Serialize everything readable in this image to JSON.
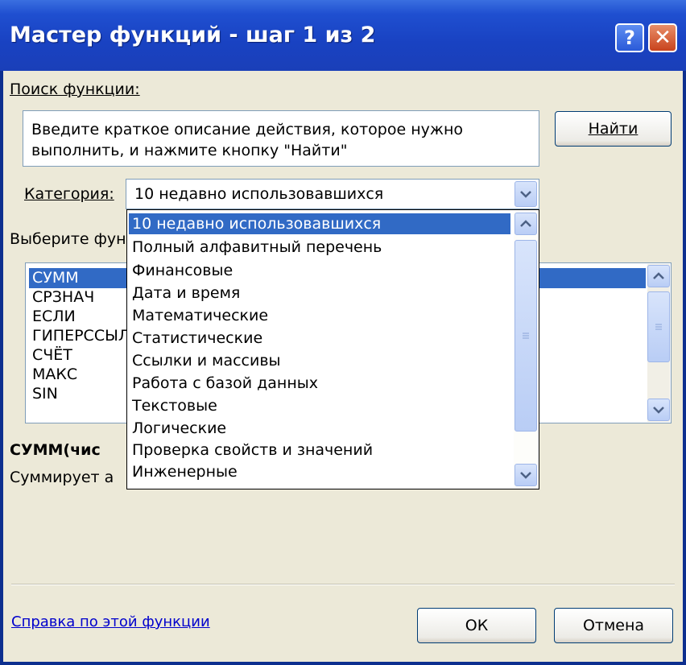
{
  "window": {
    "title": "Мастер функций - шаг 1 из 2",
    "help_glyph": "?",
    "close_glyph": "✕"
  },
  "search": {
    "label": "Поиск функции:",
    "description": "Введите краткое описание действия, которое нужно выполнить, и нажмите кнопку \"Найти\"",
    "find_button": "Найти"
  },
  "category": {
    "label": "Категория:",
    "selected": "10 недавно использовавшихся",
    "options": [
      "10 недавно использовавшихся",
      "Полный алфавитный перечень",
      "Финансовые",
      "Дата и время",
      "Математические",
      "Статистические",
      "Ссылки и массивы",
      "Работа с базой данных",
      "Текстовые",
      "Логические",
      "Проверка свойств и значений",
      "Инженерные"
    ]
  },
  "functions": {
    "label_visible": "Выберите фун",
    "items_visible": [
      "СУММ",
      "СРЗНАЧ",
      "ЕСЛИ",
      "ГИПЕРССЫЛ",
      "СЧЁТ",
      "МАКС",
      "SIN"
    ],
    "selected": "СУММ",
    "signature_visible": "СУММ(чис",
    "description_visible": "Суммирует а"
  },
  "footer": {
    "help_link": "Справка по этой функции",
    "ok_button": "ОК",
    "cancel_button": "Отмена"
  },
  "colors": {
    "titlebar": "#1f4fd0",
    "dialog_bg": "#ece9d8",
    "selection": "#316ac5",
    "link": "#0000cc"
  }
}
